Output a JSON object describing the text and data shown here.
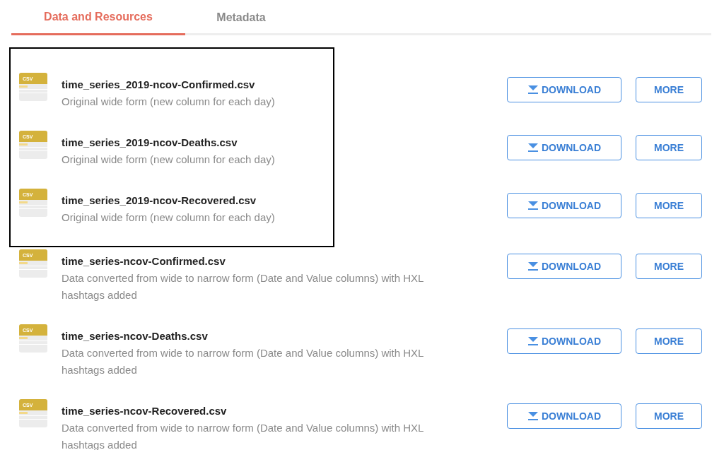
{
  "tabs": [
    {
      "label": "Data and Resources",
      "selected": true
    },
    {
      "label": "Metadata",
      "selected": false
    }
  ],
  "resources": [
    {
      "icon_label": "CSV",
      "name": "time_series_2019-ncov-Confirmed.csv",
      "description": "Original wide form (new column for each day)",
      "highlighted": true,
      "download": "DOWNLOAD",
      "more": "MORE"
    },
    {
      "icon_label": "CSV",
      "name": "time_series_2019-ncov-Deaths.csv",
      "description": "Original wide form (new column for each day)",
      "highlighted": true,
      "download": "DOWNLOAD",
      "more": "MORE"
    },
    {
      "icon_label": "CSV",
      "name": "time_series_2019-ncov-Recovered.csv",
      "description": "Original wide form (new column for each day)",
      "highlighted": true,
      "download": "DOWNLOAD",
      "more": "MORE"
    },
    {
      "icon_label": "CSV",
      "name": "time_series-ncov-Confirmed.csv",
      "description": "Data converted from wide to narrow form (Date and Value columns) with HXL hashtags added",
      "highlighted": false,
      "download": "DOWNLOAD",
      "more": "MORE"
    },
    {
      "icon_label": "CSV",
      "name": "time_series-ncov-Deaths.csv",
      "description": "Data converted from wide to narrow form (Date and Value columns) with HXL hashtags added",
      "highlighted": false,
      "download": "DOWNLOAD",
      "more": "MORE"
    },
    {
      "icon_label": "CSV",
      "name": "time_series-ncov-Recovered.csv",
      "description": "Data converted from wide to narrow form (Date and Value columns) with HXL hashtags added",
      "highlighted": false,
      "download": "DOWNLOAD",
      "more": "MORE"
    }
  ]
}
